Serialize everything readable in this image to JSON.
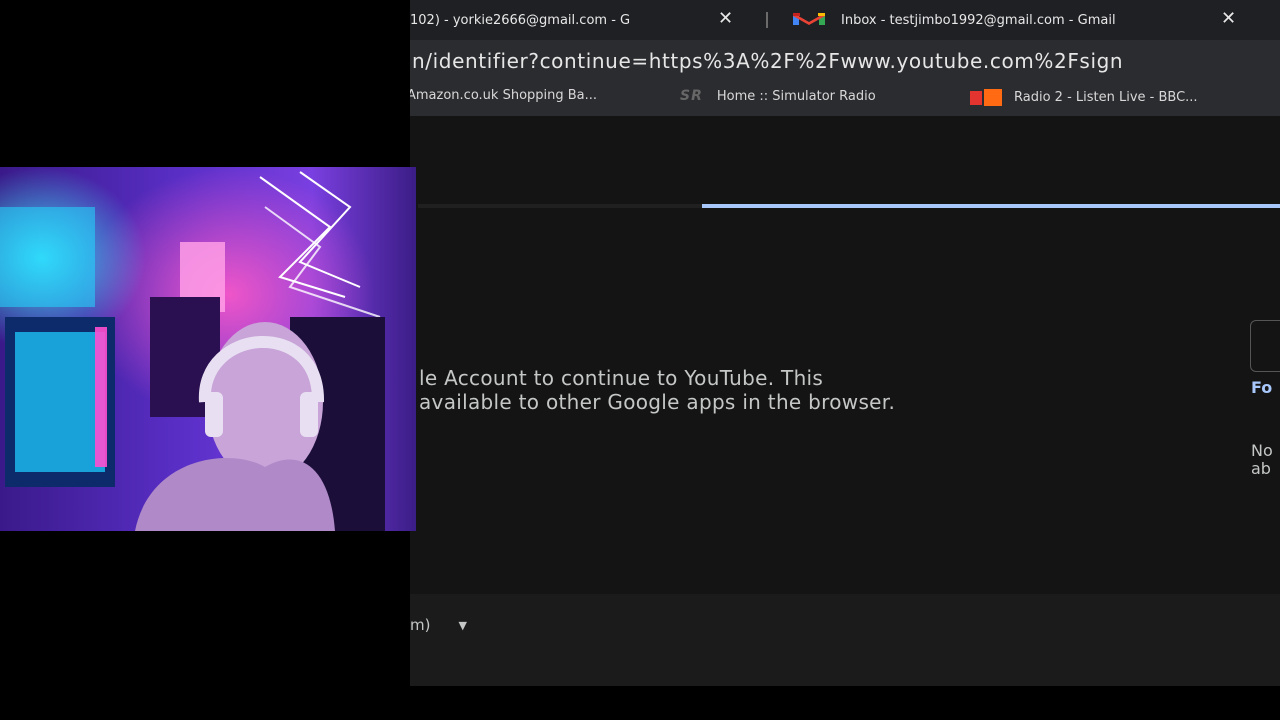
{
  "browser": {
    "tabs": [
      {
        "label": "102) - yorkie2666@gmail.com - G",
        "close": "✕"
      },
      {
        "label": "Inbox - testjimbo1992@gmail.com - Gmail",
        "close": "✕",
        "icon": "gmail-icon"
      }
    ],
    "address_bar": {
      "url": "n/identifier?continue=https%3A%2F%2Fwww.youtube.com%2Fsign"
    },
    "bookmarks": [
      {
        "label": "Amazon.co.uk Shopping Ba..."
      },
      {
        "label": "Home :: Simulator Radio",
        "icon_text": "SR"
      },
      {
        "label": "Radio 2 - Listen Live - BBC...",
        "icon": "bbc-radio-icon"
      }
    ]
  },
  "signin": {
    "loading_progress": 0.67,
    "description_line1": "le Account to continue to YouTube. This",
    "description_line2": "available to other Google apps in the browser.",
    "forgot_link": "Fo",
    "note_line1": "No",
    "note_line2": "ab"
  },
  "footer": {
    "language": "m)"
  },
  "colors": {
    "accent": "#a8c7fa",
    "page_bg": "#141414",
    "tabstrip_bg": "#1f2024",
    "toolbar_bg": "#2b2c30"
  }
}
